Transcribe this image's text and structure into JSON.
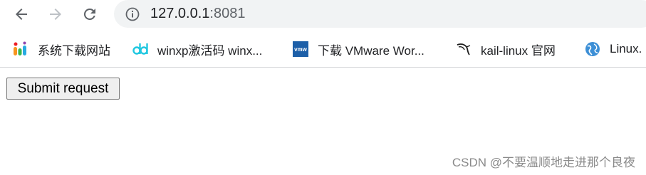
{
  "browser": {
    "address_bar": {
      "host": "127.0.0.1",
      "port": ":8081"
    },
    "icons": {
      "back": "back-arrow-icon",
      "forward": "forward-arrow-icon",
      "reload": "reload-icon",
      "info": "info-icon"
    },
    "bookmarks": [
      {
        "label": "系统下载网站",
        "icon": "colorful-u-logo-icon"
      },
      {
        "label": "winxp激活码 winx...",
        "icon": "cyan-dd-logo-icon"
      },
      {
        "label": "下载 VMware Wor...",
        "icon": "vmw-logo-icon"
      },
      {
        "label": "kail-linux 官网",
        "icon": "kali-dragon-icon"
      },
      {
        "label": "Linux.",
        "icon": "globe-icon"
      }
    ]
  },
  "page": {
    "submit_button_label": "Submit request"
  },
  "watermark": "CSDN @不要温顺地走进那个良夜",
  "colors": {
    "omnibox_bg": "#f1f3f4",
    "button_bg": "#efefef",
    "vmw_blue": "#1d5fa8",
    "dd_cyan": "#1fc7e0"
  }
}
